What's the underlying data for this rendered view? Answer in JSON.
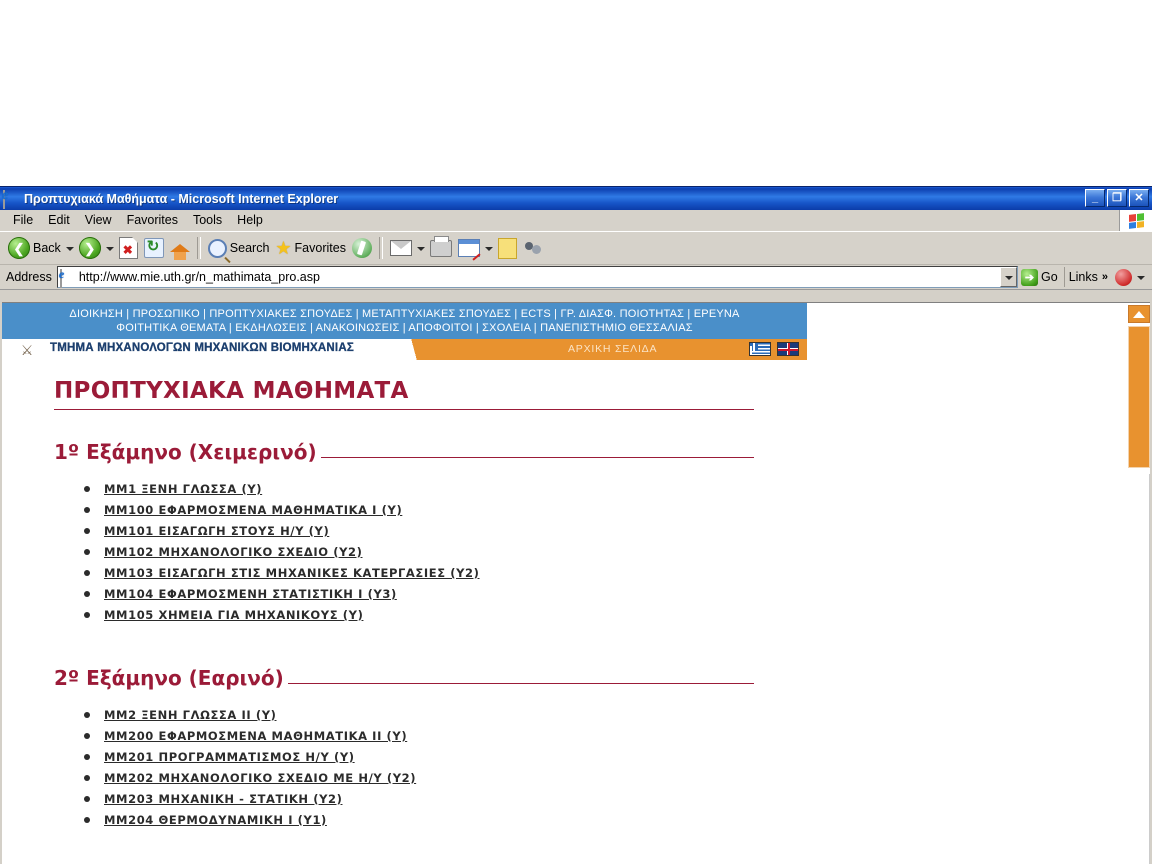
{
  "window": {
    "title": "Προπτυχιακά Μαθήματα - Microsoft Internet Explorer",
    "app_icon": "ie-page-icon",
    "minimize": "_",
    "maximize": "❐",
    "close": "✕"
  },
  "menubar": {
    "items": [
      {
        "label": "File"
      },
      {
        "label": "Edit"
      },
      {
        "label": "View"
      },
      {
        "label": "Favorites"
      },
      {
        "label": "Tools"
      },
      {
        "label": "Help"
      }
    ],
    "logo_icon": "windows-flag-icon"
  },
  "toolbar": {
    "back_label": "Back",
    "forward_label": "",
    "search_label": "Search",
    "favorites_label": "Favorites",
    "icons": [
      "back-icon",
      "back-dropdown-icon",
      "forward-icon",
      "forward-dropdown-icon",
      "stop-icon",
      "refresh-icon",
      "home-icon",
      "search-icon",
      "favorites-star-icon",
      "media-icon",
      "mail-icon",
      "print-icon",
      "edit-icon",
      "notes-icon",
      "messenger-icon"
    ]
  },
  "address_bar": {
    "label": "Address",
    "url": "http://www.mie.uth.gr/n_mathimata_pro.asp",
    "favicon": "ie-page-icon",
    "dropdown_icon": "chevron-down-icon",
    "go_label": "Go",
    "go_icon": "green-arrow-icon",
    "links_label": "Links",
    "links_chevron": "»",
    "pdf_icon": "acrobat-icon",
    "pdf_chevron": "chevron-down-icon"
  },
  "site": {
    "nav_row1": "ΔΙΟΙΚΗΣΗ | ΠΡΟΣΩΠΙΚΟ | ΠΡΟΠΤΥΧΙΑΚΕΣ ΣΠΟΥΔΕΣ | ΜΕΤΑΠΤΥΧΙΑΚΕΣ ΣΠΟΥΔΕΣ | ECTS | ΓΡ. ΔΙΑΣΦ. ΠΟΙΟΤΗΤΑΣ | ΕΡΕΥΝΑ",
    "nav_row2": "ΦΟΙΤΗΤΙΚΑ ΘΕΜΑΤΑ | ΕΚΔΗΛΩΣΕΙΣ | ΑΝΑΚΟΙΝΩΣΕΙΣ | ΑΠΟΦΟΙΤΟΙ | ΣΧΟΛΕΙΑ | ΠΑΝΕΠΙΣΤΗΜΙΟ ΘΕΣΣΑΛΙΑΣ",
    "department_name": "ΤΜΗΜΑ ΜΗΧΑΝΟΛΟΓΩΝ ΜΗΧΑΝΙΚΩΝ ΒΙΟΜΗΧΑΝΙΑΣ",
    "home_link": "ΑΡΧΙΚΗ ΣΕΛΙΔΑ",
    "logo_icon": "department-emblem-icon",
    "flag_gr_icon": "greek-flag-icon",
    "flag_en_icon": "uk-flag-icon",
    "nav_bg_color": "#4a8fc9",
    "band_color": "#e8922f",
    "heading_color": "#9b1b38"
  },
  "page": {
    "title": "ΠΡΟΠΤΥΧΙΑΚΑ ΜΑΘΗΜΑΤΑ",
    "semesters": [
      {
        "title": "1º Εξάμηνο (Χειμερινό)",
        "courses": [
          "ΜΜ1 ΞΕΝΗ ΓΛΩΣΣΑ (Υ)",
          "ΜΜ100 ΕΦΑΡΜΟΣΜΕΝΑ ΜΑΘΗΜΑΤΙΚΑ Ι (Υ)",
          "ΜΜ101 ΕΙΣΑΓΩΓΗ ΣΤΟΥΣ Η/Υ (Υ)",
          "ΜΜ102 ΜΗΧΑΝΟΛΟΓΙΚΟ ΣΧΕΔΙΟ (Υ2)",
          "ΜΜ103 ΕΙΣΑΓΩΓΗ ΣΤΙΣ ΜΗΧΑΝΙΚΕΣ ΚΑΤΕΡΓΑΣΙΕΣ (Υ2)",
          "ΜΜ104 ΕΦΑΡΜΟΣΜΕΝΗ ΣΤΑΤΙΣΤΙΚΗ Ι (Υ3)",
          "ΜΜ105 ΧΗΜΕΙΑ ΓΙΑ ΜΗΧΑΝΙΚΟΥΣ (Υ)"
        ]
      },
      {
        "title": "2º Εξάμηνο (Εαρινό)",
        "courses": [
          "ΜΜ2 ΞΕΝΗ ΓΛΩΣΣΑ ΙΙ (Υ)",
          "ΜΜ200 ΕΦΑΡΜΟΣΜΕΝΑ ΜΑΘΗΜΑΤΙΚΑ ΙΙ (Υ)",
          "ΜΜ201 ΠΡΟΓΡΑΜΜΑΤΙΣΜΟΣ Η/Υ (Υ)",
          "ΜΜ202 ΜΗΧΑΝΟΛΟΓΙΚΟ ΣΧΕΔΙΟ ΜΕ Η/Υ (Υ2)",
          "ΜΜ203 ΜΗΧΑΝΙΚΗ - ΣΤΑΤΙΚΗ (Υ2)",
          "ΜΜ204 ΘΕΡΜΟΔΥΝΑΜΙΚΗ Ι (Υ1)"
        ]
      }
    ]
  },
  "scrollbar": {
    "up_arrow_icon": "scroll-up-arrow-icon",
    "thumb": "scroll-thumb"
  }
}
